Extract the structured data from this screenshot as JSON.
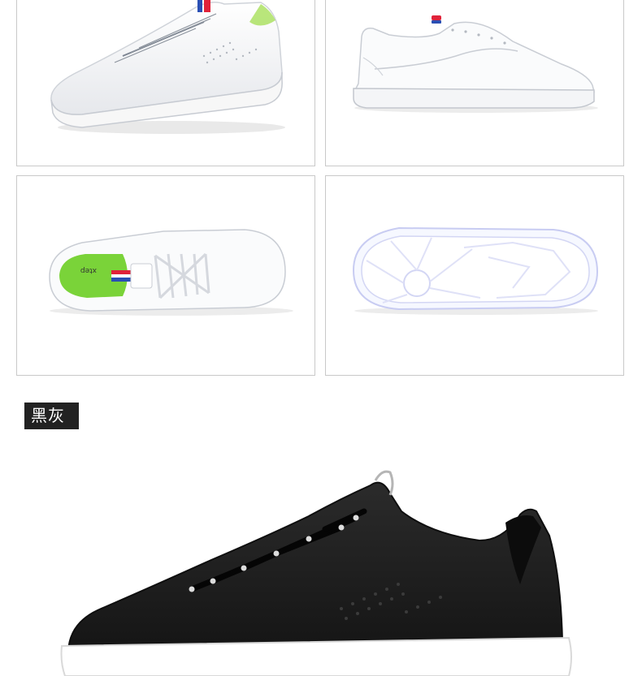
{
  "product_views": [
    {
      "view": "side",
      "colorway": "white"
    },
    {
      "view": "inner-side",
      "colorway": "white"
    },
    {
      "view": "top",
      "colorway": "white"
    },
    {
      "view": "sole",
      "colorway": "white"
    }
  ],
  "colorway_section": {
    "label": "黑灰"
  },
  "tongue_brand_text": "xtep",
  "colors": {
    "shoe_white": "#f4f5f7",
    "shoe_black": "#1e1e1e",
    "accent_red": "#e0223a",
    "accent_blue": "#2a4fb4",
    "insole_green": "#7ad339"
  }
}
